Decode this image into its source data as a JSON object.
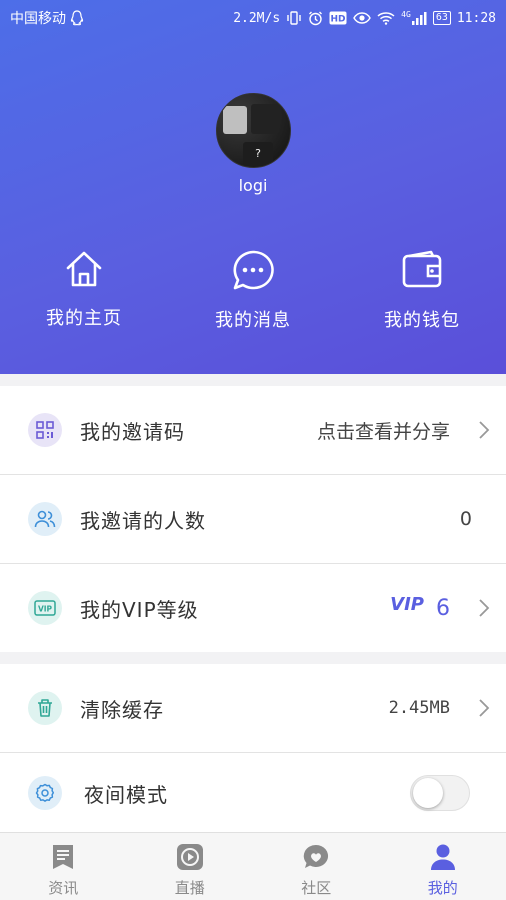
{
  "status_bar": {
    "carrier": "中国移动",
    "speed": "2.2M/s",
    "signal_label": "4G",
    "battery": "63",
    "time": "11:28"
  },
  "profile": {
    "username": "logi",
    "avatar_key_label": "?"
  },
  "quick_actions": [
    {
      "label": "我的主页",
      "icon": "home-icon"
    },
    {
      "label": "我的消息",
      "icon": "message-icon"
    },
    {
      "label": "我的钱包",
      "icon": "wallet-icon"
    }
  ],
  "settings": {
    "invite_code": {
      "title": "我的邀请码",
      "value": "点击查看并分享",
      "icon": "qrcode-icon"
    },
    "invite_count": {
      "title": "我邀请的人数",
      "value": "0",
      "icon": "users-icon"
    },
    "vip_level": {
      "title": "我的VIP等级",
      "badge": "VIP",
      "value": "6",
      "icon": "vip-icon"
    },
    "clear_cache": {
      "title": "清除缓存",
      "value": "2.45MB",
      "icon": "trash-icon"
    },
    "night_mode": {
      "title": "夜间模式",
      "enabled": false,
      "icon": "gear-icon"
    }
  },
  "tabs": [
    {
      "label": "资讯",
      "icon": "news-icon",
      "active": false
    },
    {
      "label": "直播",
      "icon": "play-icon",
      "active": false
    },
    {
      "label": "社区",
      "icon": "community-icon",
      "active": false
    },
    {
      "label": "我的",
      "icon": "user-icon",
      "active": true
    }
  ],
  "colors": {
    "accent": "#5a5fe0",
    "header_top": "#4d6ee8",
    "header_bottom": "#5a4fd9"
  }
}
